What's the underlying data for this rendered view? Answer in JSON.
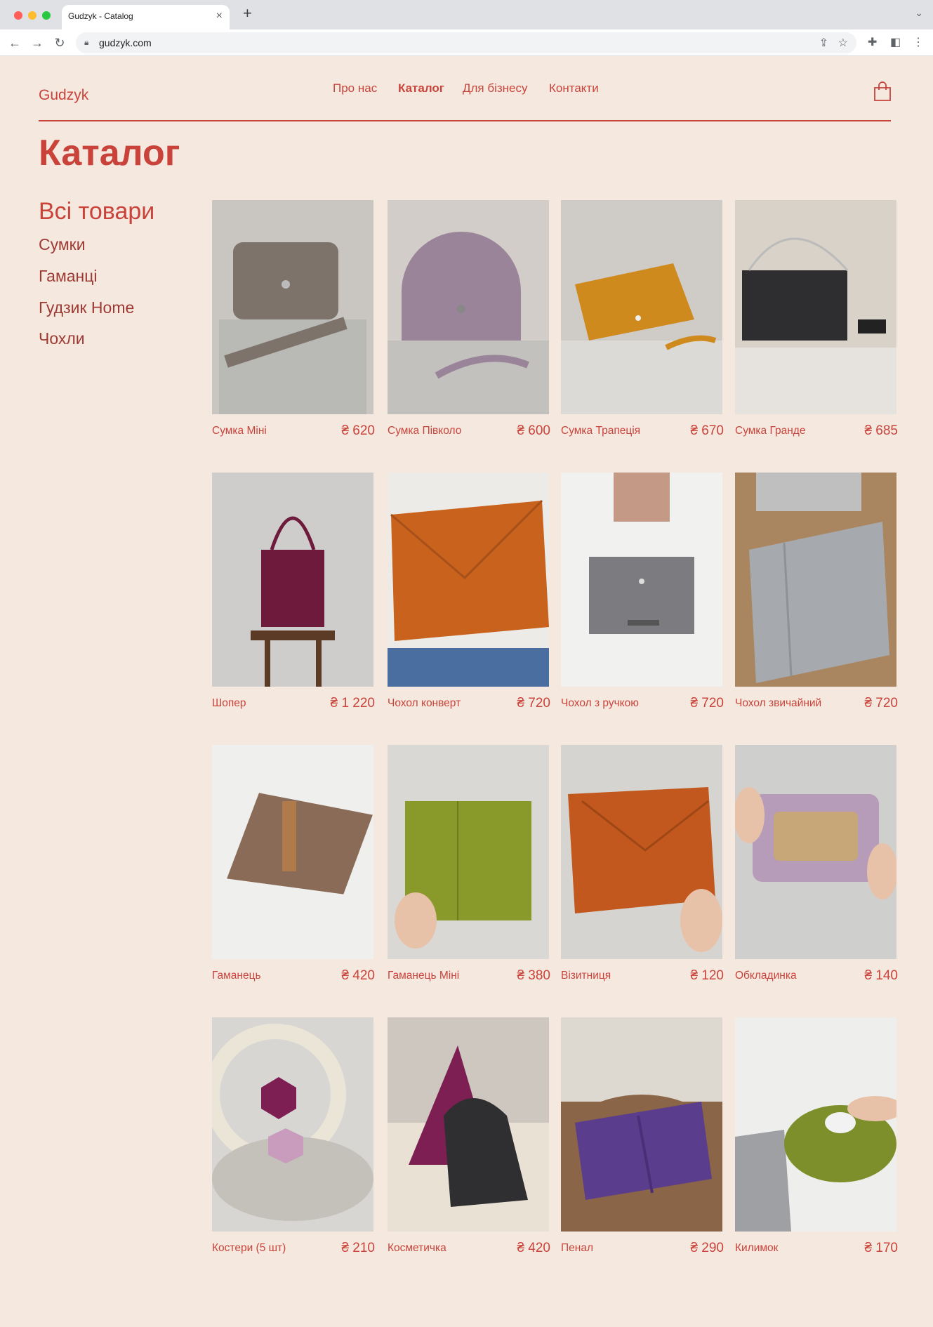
{
  "browser": {
    "tab_title": "Gudzyk - Catalog",
    "url": "gudzyk.com"
  },
  "header": {
    "logo": "Gudzyk",
    "nav": [
      "Про нас",
      "Каталог",
      "Для бізнесу",
      "Контакти"
    ],
    "active_nav": "Каталог"
  },
  "page_title": "Каталог",
  "sidebar": {
    "items": [
      "Всі товари",
      "Сумки",
      "Гаманці",
      "Гудзик Home",
      "Чохли"
    ],
    "active": "Всі товари"
  },
  "products": [
    {
      "name": "Сумка Міні",
      "price": "₴ 620",
      "color": "#7d736b",
      "bg": "#c9c6c2"
    },
    {
      "name": "Сумка Півколо",
      "price": "₴ 600",
      "color": "#9a8499",
      "bg": "#d2cdc9"
    },
    {
      "name": "Сумка Трапеція",
      "price": "₴ 670",
      "color": "#cf8a1e",
      "bg": "#cfcbc6"
    },
    {
      "name": "Сумка Гранде",
      "price": "₴ 685",
      "color": "#2e2e30",
      "bg": "#d9d2c8"
    },
    {
      "name": "Шопер",
      "price": "₴ 1 220",
      "color": "#6e1a3c",
      "bg": "#cfcdcc"
    },
    {
      "name": "Чохол конверт",
      "price": "₴ 720",
      "color": "#c8621c",
      "bg": "#e8e6e2"
    },
    {
      "name": "Чохол з ручкою",
      "price": "₴ 720",
      "color": "#7c7c80",
      "bg": "#e6e5e3"
    },
    {
      "name": "Чохол звичайний",
      "price": "₴ 720",
      "color": "#a6a9ad",
      "bg": "#a9865f"
    },
    {
      "name": "Гаманець",
      "price": "₴ 420",
      "color": "#8a6b57",
      "bg": "#e4e3e1"
    },
    {
      "name": "Гаманець Міні",
      "price": "₴ 380",
      "color": "#8a9a2a",
      "bg": "#d9d8d5"
    },
    {
      "name": "Візитниця",
      "price": "₴ 120",
      "color": "#c2581d",
      "bg": "#d6d4d1"
    },
    {
      "name": "Обкладинка",
      "price": "₴ 140",
      "color": "#b69cb8",
      "bg": "#cfcfcd"
    },
    {
      "name": "Костери (5 шт)",
      "price": "₴ 210",
      "color": "#7d1f52",
      "bg": "#d8d6d3"
    },
    {
      "name": "Косметичка",
      "price": "₴ 420",
      "color": "#2f2f31",
      "bg": "#cdc7bf"
    },
    {
      "name": "Пенал",
      "price": "₴ 290",
      "color": "#5a3d8d",
      "bg": "#8b6547"
    },
    {
      "name": "Килимок",
      "price": "₴ 170",
      "color": "#7d8f2a",
      "bg": "#e9e8e6"
    }
  ]
}
